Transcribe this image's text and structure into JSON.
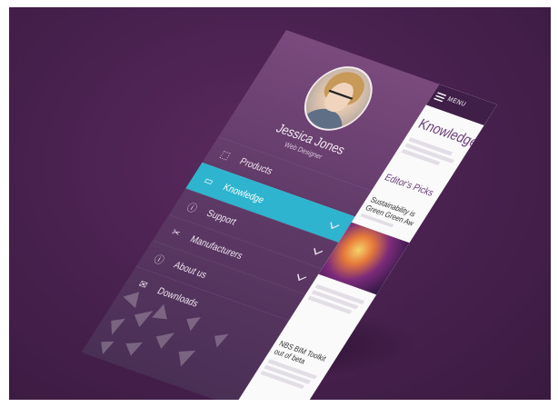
{
  "profile": {
    "name": "Jessica Jones",
    "role": "Web Designer"
  },
  "menu": {
    "items": [
      {
        "label": "Products",
        "icon": "box-icon",
        "expandable": false,
        "active": false
      },
      {
        "label": "Knowledge",
        "icon": "chat-bubble-icon",
        "expandable": true,
        "active": true
      },
      {
        "label": "Support",
        "icon": "info-icon",
        "expandable": true,
        "active": false
      },
      {
        "label": "Manufacturers",
        "icon": "tools-icon",
        "expandable": true,
        "active": false
      },
      {
        "label": "About us",
        "icon": "info-circle-icon",
        "expandable": false,
        "active": false
      },
      {
        "label": "Downloads",
        "icon": "envelope-icon",
        "expandable": false,
        "active": false
      }
    ]
  },
  "content": {
    "menu_button_label": "MENU",
    "page_title": "Knowledge",
    "section_title": "Editor's Picks",
    "article_1_line_1": "Sustainability is",
    "article_1_line_2": "Green Green Aw",
    "article_2_line_1": "NBS BIM Toolkit",
    "article_2_line_2": "out of beta"
  },
  "colors": {
    "background": "#4a2250",
    "menu_top": "#7a4a7d",
    "menu_bottom": "#4a2f55",
    "active_item": "#2fb4cf",
    "accent_text": "#6a3d78",
    "topbar": "#3f1f47"
  }
}
